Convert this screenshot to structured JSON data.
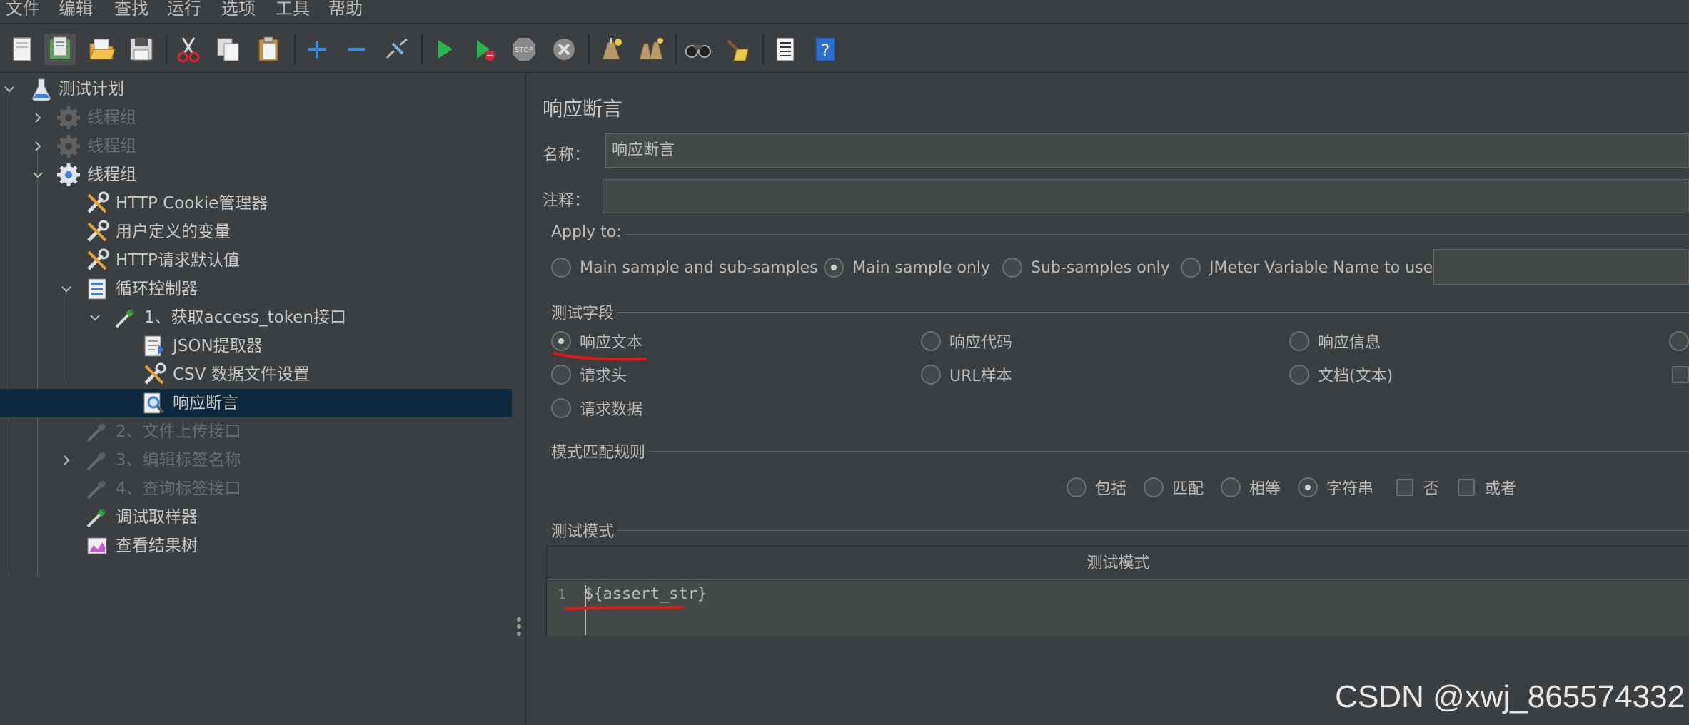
{
  "menu": [
    "文件",
    "编辑",
    "查找",
    "运行",
    "选项",
    "工具",
    "帮助"
  ],
  "toolbar": [
    "new-icon",
    "templates-icon",
    "open-icon",
    "save-icon",
    "cut-icon",
    "copy-icon",
    "paste-icon",
    "expand-icon",
    "collapse-icon",
    "toggle-icon",
    "start-icon",
    "start-no-pause-icon",
    "stop-icon",
    "shutdown-icon",
    "clear-icon",
    "clear-all-icon",
    "search-icon",
    "reset-search-icon",
    "function-helper-icon",
    "help-icon"
  ],
  "tree": {
    "items": [
      {
        "label": "测试计划",
        "icon": "test-plan-icon",
        "expanded": true,
        "disabled": false
      },
      {
        "label": "线程组",
        "icon": "thread-group-icon",
        "expanded": false,
        "disabled": true
      },
      {
        "label": "线程组",
        "icon": "thread-group-icon",
        "expanded": false,
        "disabled": true
      },
      {
        "label": "线程组",
        "icon": "thread-group-icon",
        "expanded": true,
        "disabled": false
      },
      {
        "label": "HTTP Cookie管理器",
        "icon": "config-wrench-icon",
        "disabled": false
      },
      {
        "label": "用户定义的变量",
        "icon": "config-wrench-icon",
        "disabled": false
      },
      {
        "label": "HTTP请求默认值",
        "icon": "config-wrench-icon",
        "disabled": false
      },
      {
        "label": "循环控制器",
        "icon": "loop-controller-icon",
        "expanded": true,
        "disabled": false
      },
      {
        "label": "1、获取access_token接口",
        "icon": "sampler-pipette-icon",
        "expanded": true,
        "disabled": false
      },
      {
        "label": "JSON提取器",
        "icon": "extractor-icon",
        "disabled": false
      },
      {
        "label": "CSV 数据文件设置",
        "icon": "config-wrench-icon",
        "disabled": false
      },
      {
        "label": "响应断言",
        "icon": "assertion-magnifier-icon",
        "disabled": false,
        "selected": true
      },
      {
        "label": "2、文件上传接口",
        "icon": "sampler-pipette-icon",
        "disabled": true
      },
      {
        "label": "3、编辑标签名称",
        "icon": "sampler-pipette-icon",
        "expanded": false,
        "disabled": true
      },
      {
        "label": "4、查询标签接口",
        "icon": "sampler-pipette-icon",
        "disabled": true
      },
      {
        "label": "调试取样器",
        "icon": "sampler-pipette-icon",
        "disabled": false
      },
      {
        "label": "查看结果树",
        "icon": "listener-graph-icon",
        "disabled": false
      }
    ]
  },
  "panel": {
    "title": "响应断言",
    "name_label": "名称：",
    "name_value": "响应断言",
    "comment_label": "注释：",
    "comment_value": "",
    "apply_to": {
      "legend": "Apply to:",
      "options": [
        "Main sample and sub-samples",
        "Main sample only",
        "Sub-samples only",
        "JMeter Variable Name to use"
      ],
      "selected": "Main sample only",
      "variable_value": ""
    },
    "field_to_test": {
      "legend": "测试字段",
      "options": [
        "响应文本",
        "响应代码",
        "响应信息",
        "请求头",
        "URL样本",
        "文档(文本)",
        "请求数据"
      ],
      "selected": "响应文本"
    },
    "matching_rules": {
      "legend": "模式匹配规则",
      "radios": [
        "包括",
        "匹配",
        "相等",
        "字符串"
      ],
      "selected": "字符串",
      "checkboxes": [
        "否",
        "或者"
      ]
    },
    "patterns": {
      "legend": "测试模式",
      "column_header": "测试模式",
      "rows": [
        {
          "line": "1",
          "value": "${assert_str}"
        }
      ]
    }
  },
  "watermark": "CSDN @xwj_865574332",
  "colors": {
    "background": "#3c3f41",
    "selection": "#0d293e",
    "annotation_red": "#e01818"
  }
}
